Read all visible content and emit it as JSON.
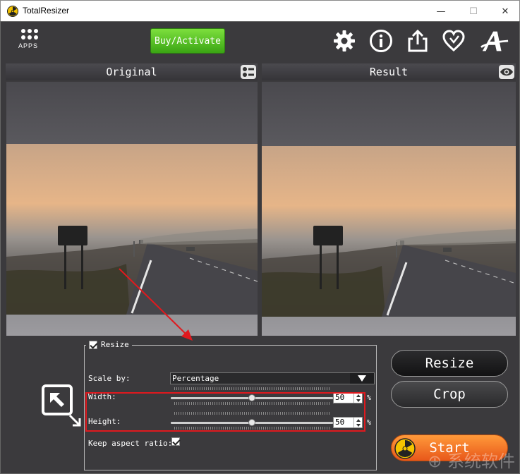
{
  "window": {
    "title": "TotalResizer",
    "minimize_glyph": "—",
    "maximize_glyph": "☐",
    "close_glyph": "✕"
  },
  "toolbar": {
    "apps_label": "APPS",
    "buy_label": "Buy/Activate",
    "icons": [
      "gear-icon",
      "info-icon",
      "share-icon",
      "heart-icon",
      "font-a-icon"
    ]
  },
  "panels": {
    "original_title": "Original",
    "result_title": "Result"
  },
  "resize": {
    "group_label": "Resize",
    "group_checked": true,
    "scale_by_label": "Scale by:",
    "scale_by_value": "Percentage",
    "width_label": "Width:",
    "width_value": "50",
    "width_unit": "%",
    "height_label": "Height:",
    "height_value": "50",
    "height_unit": "%",
    "keep_aspect_label": "Keep aspect ratio:",
    "keep_aspect_checked": true,
    "width_slider_fraction": 0.5,
    "height_slider_fraction": 0.5
  },
  "actions": {
    "resize_label": "Resize",
    "crop_label": "Crop",
    "start_label": "Start"
  },
  "watermark": "⊕ 系统软件"
}
